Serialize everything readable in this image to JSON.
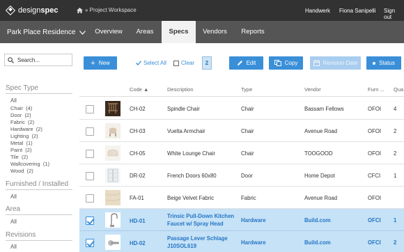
{
  "topbar": {
    "logo_text_a": "design",
    "logo_text_b": "spec",
    "breadcrumb": "» Project Workspace",
    "workspace": "Handwerk",
    "user": "Fiona Sanipelli",
    "signout": "Sign out"
  },
  "nav": {
    "project": "Park Place Residence",
    "tabs": [
      {
        "label": "Overview"
      },
      {
        "label": "Areas"
      },
      {
        "label": "Specs",
        "active": true
      },
      {
        "label": "Vendors"
      },
      {
        "label": "Reports"
      }
    ]
  },
  "sidebar": {
    "search_placeholder": "Search...",
    "sections": [
      {
        "title": "Spec Type",
        "all": "All",
        "facets": [
          {
            "label": "Chair",
            "count": "(4)"
          },
          {
            "label": "Door",
            "count": "(2)"
          },
          {
            "label": "Fabric",
            "count": "(2)"
          },
          {
            "label": "Hardware",
            "count": "(2)"
          },
          {
            "label": "Lighting",
            "count": "(2)"
          },
          {
            "label": "Metal",
            "count": "(1)"
          },
          {
            "label": "Paint",
            "count": "(2)"
          },
          {
            "label": "Tile",
            "count": "(2)"
          },
          {
            "label": "Wallcovering",
            "count": "(1)"
          },
          {
            "label": "Wood",
            "count": "(2)"
          }
        ]
      },
      {
        "title": "Furnished / Installed",
        "all": "All"
      },
      {
        "title": "Area",
        "all": "All"
      },
      {
        "title": "Revisions",
        "all": "All"
      }
    ]
  },
  "toolbar": {
    "new": "New",
    "select_all": "Select All",
    "clear": "Clear",
    "selected_count": "2",
    "edit": "Edit",
    "copy": "Copy",
    "revision_date": "Revision Date",
    "status": "Status"
  },
  "table": {
    "columns": [
      "Code ▲",
      "Description",
      "Type",
      "Vendor",
      "Furn ...",
      "Qua"
    ],
    "rows": [
      {
        "code": "CH-02",
        "description": "Spindle Chair",
        "type": "Chair",
        "vendor": "Bassam Fellows",
        "furn": "OFOI",
        "qty": "4",
        "selected": false,
        "thumb": "spindle-chair-thumbnail"
      },
      {
        "code": "CH-03",
        "description": "Vuelta Armchair",
        "type": "Chair",
        "vendor": "Avenue Road",
        "furn": "OFOI",
        "qty": "2",
        "selected": false,
        "thumb": "armchair-thumbnail"
      },
      {
        "code": "CH-05",
        "description": "White Lounge Chair",
        "type": "Chair",
        "vendor": "TOOGOOD",
        "furn": "OFOI",
        "qty": "2",
        "selected": false,
        "thumb": "lounge-chair-thumbnail"
      },
      {
        "code": "DR-02",
        "description": "French Doors 60x80",
        "type": "Door",
        "vendor": "Home Depot",
        "furn": "CFCI",
        "qty": "1",
        "selected": false,
        "thumb": "french-doors-thumbnail"
      },
      {
        "code": "FA-01",
        "description": "Beige Velvet Fabric",
        "type": "Fabric",
        "vendor": "Avenue Road",
        "furn": "OFOI",
        "qty": "",
        "selected": false,
        "thumb": "fabric-swatch-thumbnail"
      },
      {
        "code": "HD-01",
        "description": "Trinsic Pull-Down Kitchen Faucet w/ Spray Head",
        "type": "Hardware",
        "vendor": "Build.com",
        "furn": "OFCI",
        "qty": "1",
        "selected": true,
        "thumb": "faucet-thumbnail"
      },
      {
        "code": "HD-02",
        "description": "Passage Lever Schlage J10SOL619",
        "type": "Hardware",
        "vendor": "Build.com",
        "furn": "OFCI",
        "qty": "2",
        "selected": true,
        "thumb": "lever-thumbnail"
      }
    ]
  },
  "colors": {
    "accent": "#3a8fd8",
    "topbar": "#323232",
    "navbar": "#555555",
    "selected_row": "#c6e2f7"
  }
}
